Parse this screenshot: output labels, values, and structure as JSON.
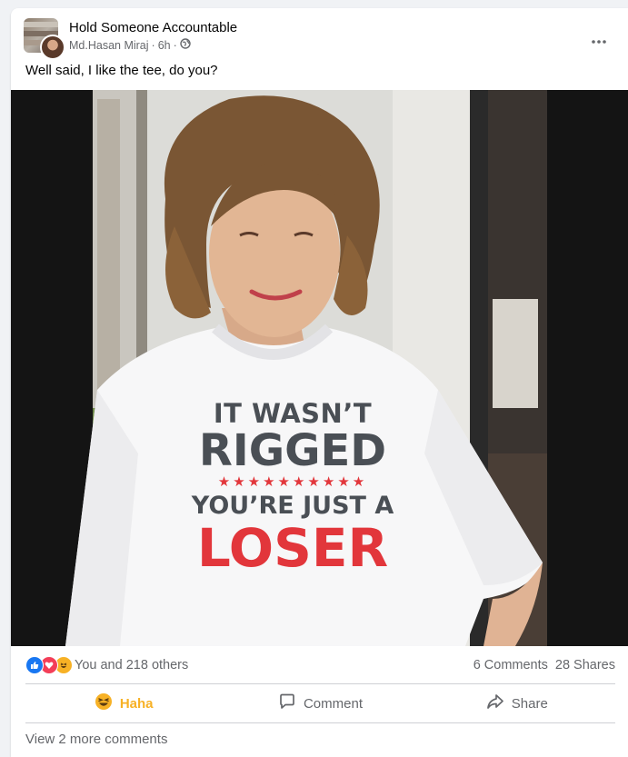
{
  "post": {
    "group_name": "Hold Someone Accountable",
    "author": "Md.Hasan Miraj",
    "time": "6h",
    "privacy_icon": "globe-icon",
    "menu_icon": "more-dots-icon",
    "caption": "Well said, I like the tee, do you?"
  },
  "photo": {
    "shirt_lines": {
      "line1": "IT WASN’T",
      "line2": "RIGGED",
      "stars": "★★★★★★★★★★",
      "line3": "YOU’RE JUST A",
      "line4": "LOSER"
    },
    "colors": {
      "shirt_text_gray": "#4a4f55",
      "shirt_text_red": "#e2363b",
      "shirt": "#f7f7f8"
    }
  },
  "stats": {
    "reaction_icons": [
      "like-icon",
      "love-icon",
      "haha-icon"
    ],
    "reactions_text": "You and 218 others",
    "comments": "6 Comments",
    "shares": "28 Shares"
  },
  "actions": {
    "haha_label": "Haha",
    "comment_label": "Comment",
    "share_label": "Share"
  },
  "footer": {
    "view_more": "View 2 more comments"
  },
  "theme": {
    "haha_color": "#f7b125",
    "like_color": "#1877f2",
    "love_color": "#f33e58",
    "secondary_text": "#65676b"
  }
}
